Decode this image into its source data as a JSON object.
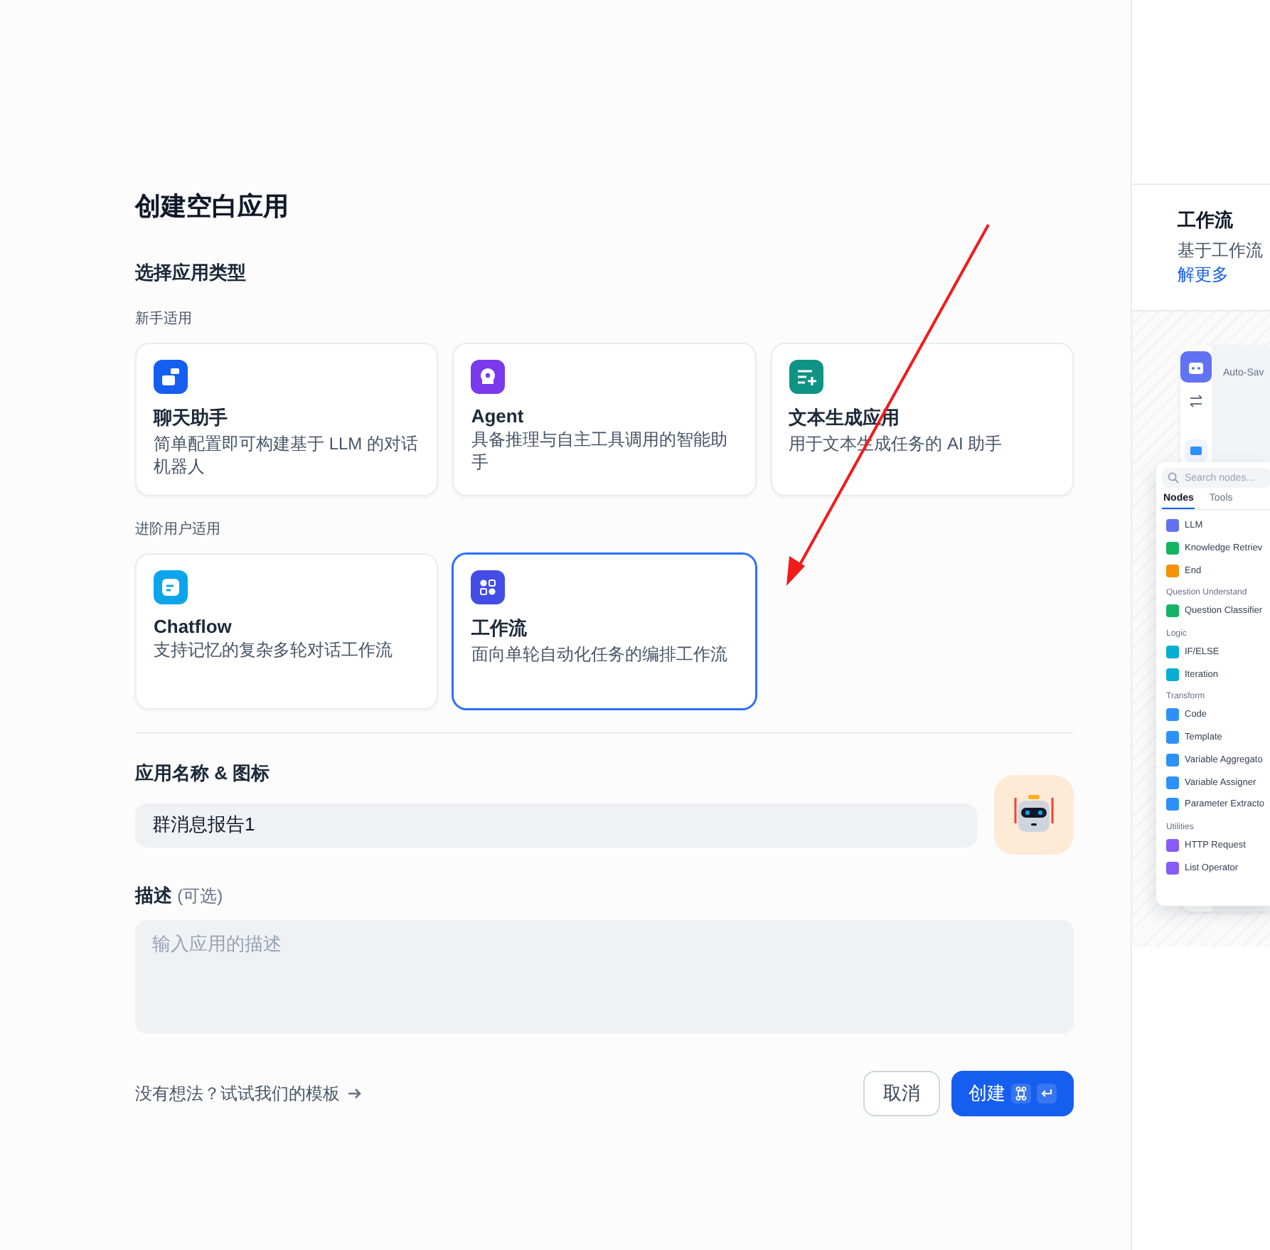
{
  "title": "创建空白应用",
  "type_heading": "选择应用类型",
  "groups": [
    {
      "label": "新手适用",
      "cards": [
        {
          "kind": "chat",
          "color": "#155eef",
          "name": "聊天助手",
          "desc": "简单配置即可构建基于 LLM 的对话机器人",
          "selected": false
        },
        {
          "kind": "agent",
          "color": "#7a39ed",
          "name": "Agent",
          "desc": "具备推理与自主工具调用的智能助手",
          "selected": false
        },
        {
          "kind": "completion",
          "color": "#0e9384",
          "name": "文本生成应用",
          "desc": "用于文本生成任务的 AI 助手",
          "selected": false
        }
      ]
    },
    {
      "label": "进阶用户适用",
      "cards": [
        {
          "kind": "chatflow",
          "color": "#0ba5ec",
          "name": "Chatflow",
          "desc": "支持记忆的复杂多轮对话工作流",
          "selected": false
        },
        {
          "kind": "workflow",
          "color": "#444ce7",
          "name": "工作流",
          "desc": "面向单轮自动化任务的编排工作流",
          "selected": true
        }
      ]
    }
  ],
  "name_field": {
    "label": "应用名称 & 图标",
    "value": "群消息报告1"
  },
  "desc_field": {
    "label": "描述",
    "optional": "(可选)",
    "placeholder": "输入应用的描述"
  },
  "template_link": "没有想法？试试我们的模板",
  "buttons": {
    "cancel": "取消",
    "create": "创建"
  },
  "preview": {
    "title": "工作流",
    "desc": "基于工作流",
    "link": "解更多",
    "canvas_label": "Auto-Sav",
    "search_placeholder": "Search nodes...",
    "tabs": [
      {
        "label": "Nodes",
        "selected": true
      },
      {
        "label": "Tools",
        "selected": false
      }
    ],
    "node_groups": [
      {
        "items": [
          {
            "label": "LLM",
            "color": "#6172f3"
          },
          {
            "label": "Knowledge Retriev",
            "color": "#16b364"
          },
          {
            "label": "End",
            "color": "#f79009"
          }
        ]
      },
      {
        "title": "Question Understand",
        "items": [
          {
            "label": "Question Classifier",
            "color": "#16b364"
          }
        ]
      },
      {
        "title": "Logic",
        "items": [
          {
            "label": "IF/ELSE",
            "color": "#06aed4"
          },
          {
            "label": "Iteration",
            "color": "#06aed4"
          }
        ]
      },
      {
        "title": "Transform",
        "items": [
          {
            "label": "Code",
            "color": "#2e90fa"
          },
          {
            "label": "Template",
            "color": "#2e90fa"
          },
          {
            "label": "Variable Aggregato",
            "color": "#2e90fa"
          },
          {
            "label": "Variable Assigner",
            "color": "#2e90fa"
          },
          {
            "label": "Parameter Extracto",
            "color": "#2e90fa"
          }
        ]
      },
      {
        "title": "Utilities",
        "items": [
          {
            "label": "HTTP Request",
            "color": "#875bf7"
          },
          {
            "label": "List Operator",
            "color": "#875bf7"
          }
        ]
      }
    ]
  }
}
